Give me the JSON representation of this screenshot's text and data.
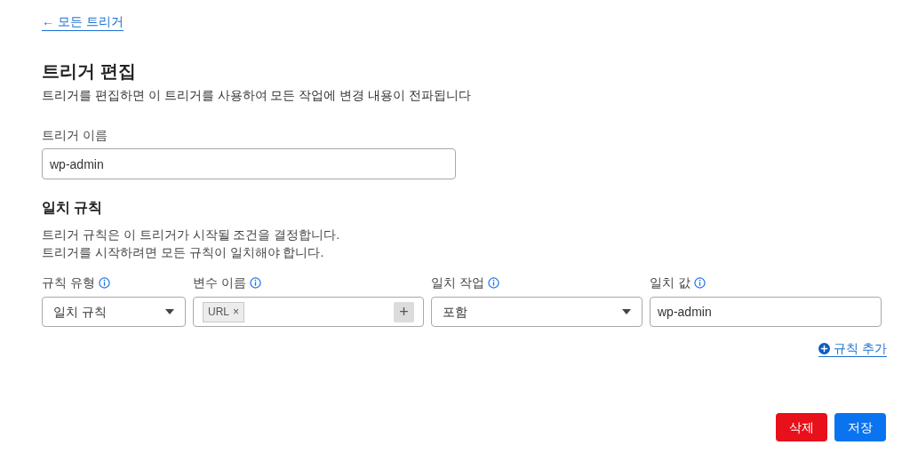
{
  "back_link": {
    "arrow": "←",
    "label": "모든 트리거"
  },
  "title": "트리거 편집",
  "subtitle": "트리거를 편집하면 이 트리거를 사용하여 모든 작업에 변경 내용이 전파됩니다",
  "name_field": {
    "label": "트리거 이름",
    "value": "wp-admin"
  },
  "rules": {
    "title": "일치 규칙",
    "description": [
      "트리거 규칙은 이 트리거가 시작될 조건을 결정합니다.",
      "트리거를 시작하려면 모든 규칙이 일치해야 합니다."
    ],
    "columns": [
      {
        "kind": "select",
        "label": "규칙 유형",
        "value": "일치 규칙"
      },
      {
        "kind": "tags",
        "label": "변수 이름",
        "tags": [
          {
            "label": "URL",
            "remove": "×"
          }
        ],
        "add": "+"
      },
      {
        "kind": "select",
        "label": "일치 작업",
        "value": "포함"
      },
      {
        "kind": "input",
        "label": "일치 값",
        "value": "wp-admin"
      }
    ],
    "add_rule": "규칙 추가"
  },
  "buttons": [
    {
      "kind": "danger",
      "label": "삭제"
    },
    {
      "kind": "primary",
      "label": "저장"
    }
  ]
}
